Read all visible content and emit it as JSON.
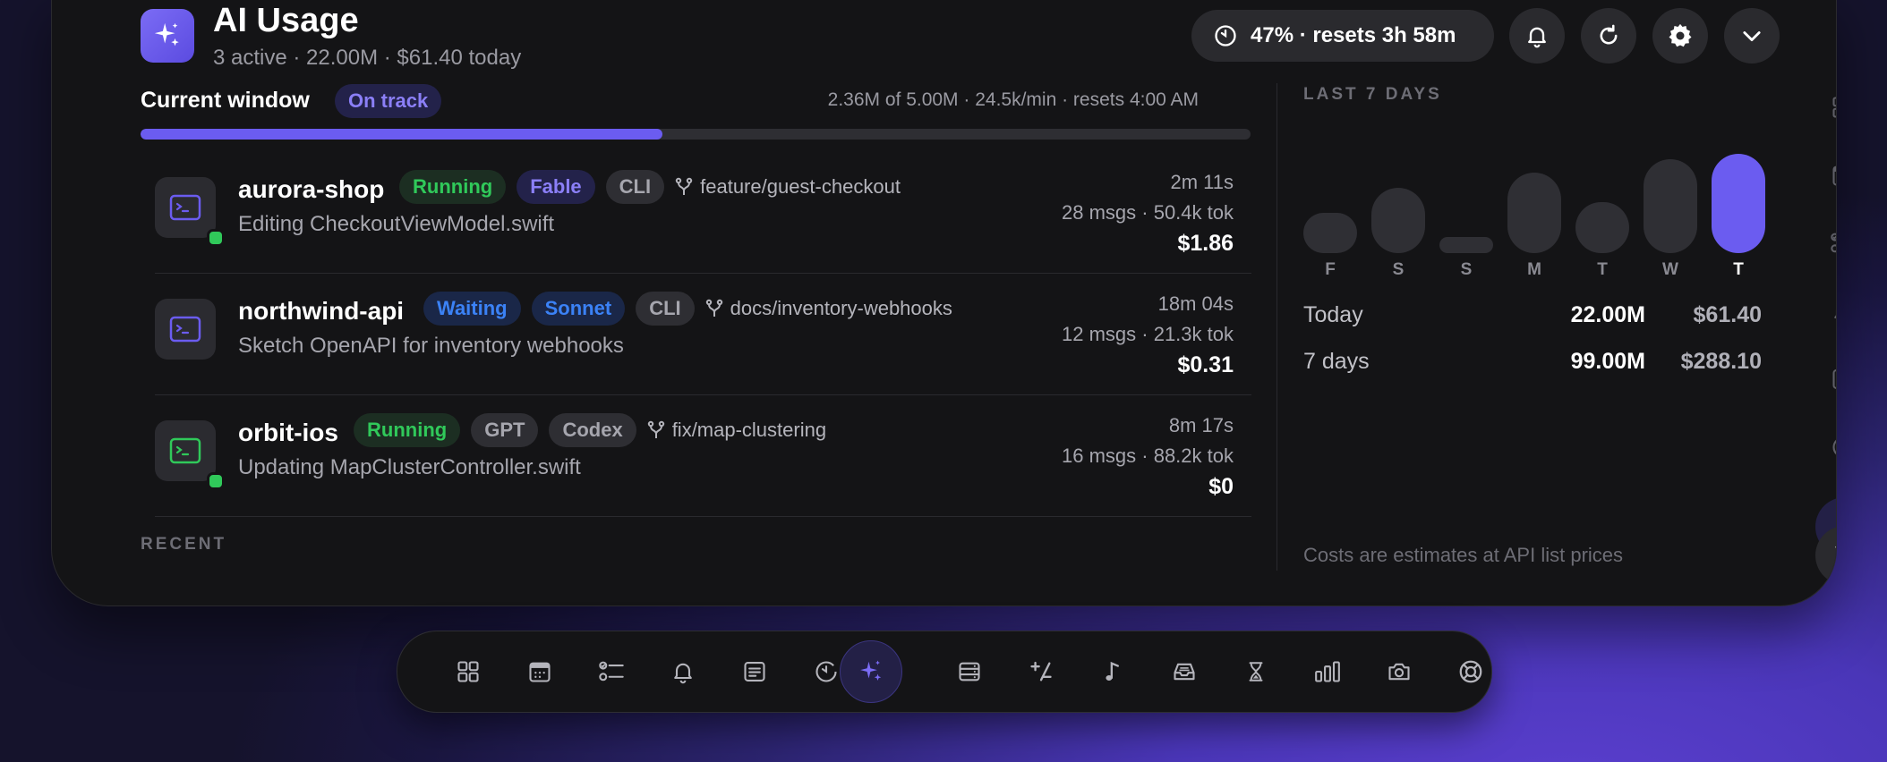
{
  "header": {
    "title": "AI Usage",
    "subtitle": "3 active · 22.00M · $61.40 today",
    "quota_pill": "47% · resets 3h 58m"
  },
  "current_window": {
    "label": "Current window",
    "status": "On track",
    "meta": "2.36M of 5.00M · 24.5k/min · resets 4:00 AM",
    "progress_fraction": 0.47
  },
  "sessions": [
    {
      "name": "aurora-shop",
      "status": "Running",
      "model": "Fable",
      "tool": "CLI",
      "branch": "feature/guest-checkout",
      "description": "Editing CheckoutViewModel.swift",
      "duration": "2m 11s",
      "stats": "28 msgs · 50.4k tok",
      "cost": "$1.86"
    },
    {
      "name": "northwind-api",
      "status": "Waiting",
      "model": "Sonnet",
      "tool": "CLI",
      "branch": "docs/inventory-webhooks",
      "description": "Sketch OpenAPI for inventory webhooks",
      "duration": "18m 04s",
      "stats": "12 msgs · 21.3k tok",
      "cost": "$0.31"
    },
    {
      "name": "orbit-ios",
      "status": "Running",
      "model": "GPT",
      "tool": "Codex",
      "branch": "fix/map-clustering",
      "description": "Updating MapClusterController.swift",
      "duration": "8m 17s",
      "stats": "16 msgs · 88.2k tok",
      "cost": "$0"
    }
  ],
  "recent_label": "RECENT",
  "last7": {
    "title": "LAST 7 DAYS",
    "days": [
      "F",
      "S",
      "S",
      "M",
      "T",
      "W",
      "T"
    ],
    "relative_usage": [
      0.32,
      0.52,
      0.05,
      0.64,
      0.41,
      0.75,
      0.79
    ],
    "highlight_index": 6
  },
  "summary": [
    {
      "label": "Today",
      "tokens": "22.00M",
      "cost": "$61.40"
    },
    {
      "label": "7 days",
      "tokens": "99.00M",
      "cost": "$288.10"
    }
  ],
  "footnote": "Costs are estimates at API list prices",
  "colors": {
    "accent": "#6b5cf0",
    "running": "#30c95a",
    "waiting": "#3b82f6",
    "badge_purple_text": "#8b7ff7"
  }
}
